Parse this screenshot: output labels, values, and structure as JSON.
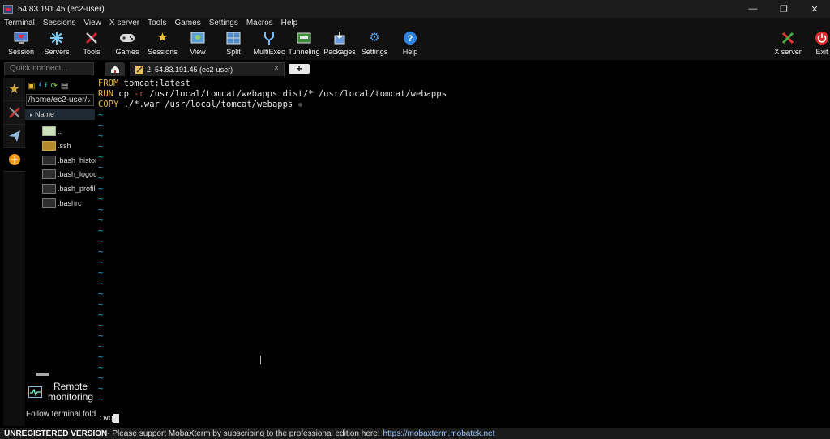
{
  "window": {
    "title": "54.83.191.45 (ec2-user)",
    "controls": [
      "—",
      "❐",
      "✕"
    ]
  },
  "menu": [
    "Terminal",
    "Sessions",
    "View",
    "X server",
    "Tools",
    "Games",
    "Settings",
    "Macros",
    "Help"
  ],
  "toolbar": [
    {
      "label": "Session",
      "icon": "monitor-icon"
    },
    {
      "label": "Servers",
      "icon": "servers-icon"
    },
    {
      "label": "Tools",
      "icon": "tools-icon"
    },
    {
      "label": "Games",
      "icon": "gamepad-icon"
    },
    {
      "label": "Sessions",
      "icon": "star-icon"
    },
    {
      "label": "View",
      "icon": "view-icon"
    },
    {
      "label": "Split",
      "icon": "split-icon"
    },
    {
      "label": "MultiExec",
      "icon": "multiexec-icon"
    },
    {
      "label": "Tunneling",
      "icon": "tunneling-icon"
    },
    {
      "label": "Packages",
      "icon": "packages-icon"
    },
    {
      "label": "Settings",
      "icon": "gears-icon"
    },
    {
      "label": "Help",
      "icon": "help-icon"
    }
  ],
  "toolbar_right": [
    {
      "label": "X server",
      "icon": "x-server-icon"
    },
    {
      "label": "Exit",
      "icon": "power-icon"
    }
  ],
  "quick_connect": {
    "placeholder": "Quick connect..."
  },
  "tabs": {
    "session_label": "2. 54.83.191.45 (ec2-user)",
    "close": "×",
    "new_tab": "+"
  },
  "sftp": {
    "path": "/home/ec2-user/",
    "column_name": "Name",
    "files": [
      {
        "name": "..",
        "type": "up"
      },
      {
        "name": ".ssh",
        "type": "folder"
      },
      {
        "name": ".bash_history",
        "type": "file"
      },
      {
        "name": ".bash_logout",
        "type": "file"
      },
      {
        "name": ".bash_profile",
        "type": "file"
      },
      {
        "name": ".bashrc",
        "type": "file"
      }
    ],
    "remote_monitoring": [
      "Remote",
      "monitoring"
    ],
    "follow_folder": "Follow terminal folder"
  },
  "terminal": {
    "line1_kw": "FROM",
    "line1_rest": " tomcat:latest",
    "line2_kw": "RUN",
    "line2_a": " cp ",
    "line2_opt": "-r",
    "line2_b": " /usr/local/tomcat/webapps.dist/* /usr/local/tomcat/webapps",
    "line3_kw": "COPY",
    "line3_rest": " ./*.war /usr/local/tomcat/webapps ",
    "tilde": "~",
    "command": ":wq"
  },
  "status": {
    "unregistered": "UNREGISTERED VERSION",
    "message": "  -  Please support MobaXterm by subscribing to the professional edition here:",
    "link": "https://mobaxterm.mobatek.net"
  }
}
